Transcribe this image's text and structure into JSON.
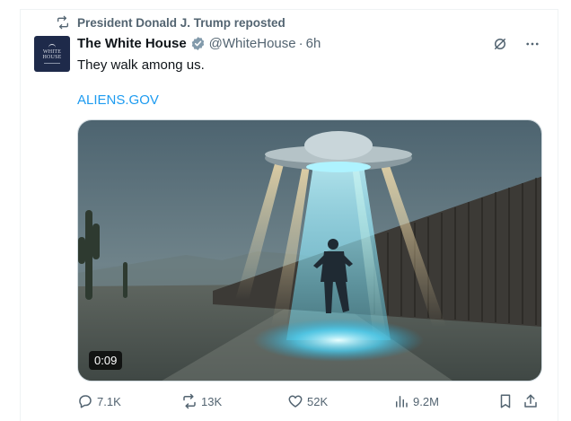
{
  "repost": {
    "text": "President Donald J. Trump reposted"
  },
  "author": {
    "name": "The White House",
    "handle": "@WhiteHouse",
    "separator": "·",
    "time": "6h",
    "avatar_text_line1": "WHITE",
    "avatar_text_line2": "HOUSE"
  },
  "tweet": {
    "text": "They walk among us.",
    "link": "ALIENS.GOV"
  },
  "media": {
    "duration": "0:09"
  },
  "actions": {
    "replies": "7.1K",
    "reposts": "13K",
    "likes": "52K",
    "views": "9.2M"
  },
  "icons": {
    "repost": "repost-icon",
    "verified": "verified-badge-icon",
    "grok": "grok-icon",
    "more": "more-icon",
    "reply": "reply-icon",
    "like": "heart-icon",
    "views": "views-icon",
    "bookmark": "bookmark-icon",
    "share": "share-icon"
  },
  "colors": {
    "link": "#1d9bf0",
    "secondary": "#536471",
    "verified": "#829aab"
  }
}
